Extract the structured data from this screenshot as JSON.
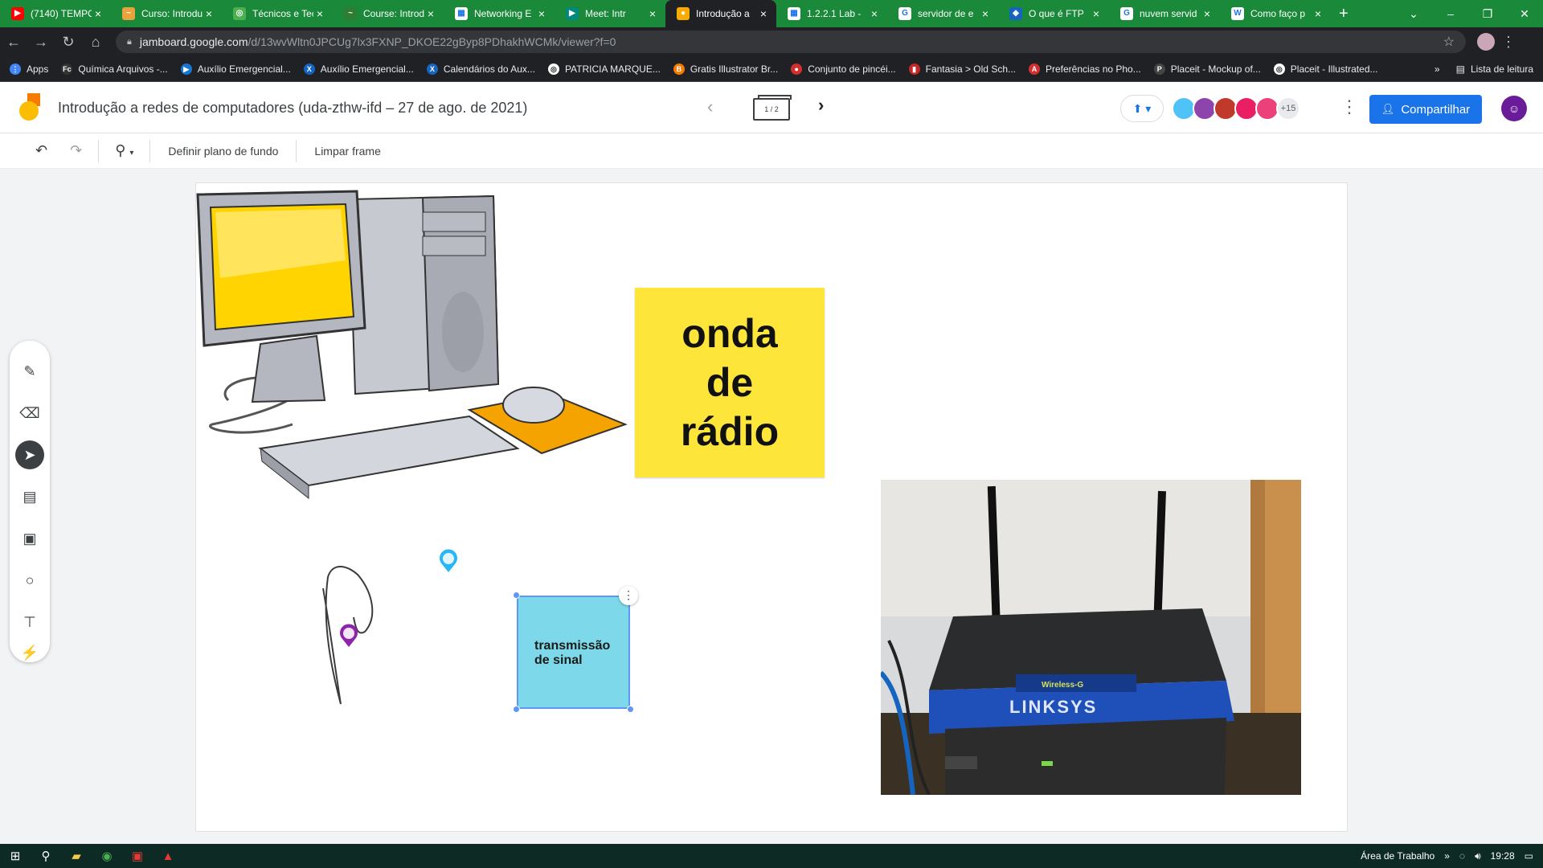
{
  "browser": {
    "tabs": [
      {
        "title": "(7140) TEMPO",
        "favicon_color": "#ff0000",
        "favicon": "▶"
      },
      {
        "title": "Curso: Introdu",
        "favicon_color": "#e8a33d",
        "favicon": "~"
      },
      {
        "title": "Técnicos e Tec",
        "favicon_color": "#4caf50",
        "favicon": "◎"
      },
      {
        "title": "Course: Introd",
        "favicon_color": "#2e7d32",
        "favicon": "~"
      },
      {
        "title": "Networking E",
        "favicon_color": "#ffffff",
        "favicon": "▦"
      },
      {
        "title": "Meet: Intr",
        "favicon_color": "#00897b",
        "favicon": "▶"
      },
      {
        "title": "Introdução a",
        "favicon_color": "#f9ab00",
        "favicon": "●",
        "active": true
      },
      {
        "title": "1.2.2.1 Lab -",
        "favicon_color": "#ffffff",
        "favicon": "▦"
      },
      {
        "title": "servidor de e",
        "favicon_color": "#ffffff",
        "favicon": "G"
      },
      {
        "title": "O que é FTP",
        "favicon_color": "#1565c0",
        "favicon": "◆"
      },
      {
        "title": "nuvem servid",
        "favicon_color": "#ffffff",
        "favicon": "G"
      },
      {
        "title": "Como faço p",
        "favicon_color": "#ffffff",
        "favicon": "W"
      }
    ],
    "address": {
      "host": "jamboard.google.com",
      "path": "/d/13wvWltn0JPCUg7lx3FXNP_DKOE22gByp8PDhakhWCMk/viewer?f=0"
    },
    "bookmarks": [
      {
        "label": "Apps",
        "color": "#4285f4",
        "glyph": "⋮"
      },
      {
        "label": "Química Arquivos -...",
        "color": "#333333",
        "glyph": "Fc"
      },
      {
        "label": "Auxílio Emergencial...",
        "color": "#1976d2",
        "glyph": "▶"
      },
      {
        "label": "Auxílio Emergencial...",
        "color": "#1565c0",
        "glyph": "X"
      },
      {
        "label": "Calendários do Aux...",
        "color": "#1565c0",
        "glyph": "X"
      },
      {
        "label": "PATRICIA MARQUE...",
        "color": "#ffffff",
        "glyph": "◎"
      },
      {
        "label": "Gratis Illustrator Br...",
        "color": "#f57c00",
        "glyph": "B"
      },
      {
        "label": "Conjunto de pincéi...",
        "color": "#d32f2f",
        "glyph": "●"
      },
      {
        "label": "Fantasia > Old Sch...",
        "color": "#c62828",
        "glyph": "▮"
      },
      {
        "label": "Preferências no Pho...",
        "color": "#d32f2f",
        "glyph": "A"
      },
      {
        "label": "Placeit - Mockup of...",
        "color": "#444444",
        "glyph": "P"
      },
      {
        "label": "Placeit - Illustrated...",
        "color": "#ffffff",
        "glyph": "◎"
      }
    ],
    "bookmarks_more": "»",
    "reading_list": "Lista de leitura"
  },
  "jamboard": {
    "title": "Introdução a redes de computadores (uda-zthw-ifd – 27 de ago. de 2021)",
    "frame_indicator": "1 / 2",
    "collaborators_more": "+15",
    "share_label": "Compartilhar",
    "toolbar": {
      "set_background": "Definir plano de fundo",
      "clear_frame": "Limpar frame"
    },
    "sticky_yellow": {
      "text": "onda\nde\nrádio",
      "color": "#fde53a"
    },
    "sticky_blue": {
      "text": "transmissão\nde sinal",
      "color": "#7dd9e9"
    },
    "router_brand": "LINKSYS",
    "router_label": "Wireless-G"
  },
  "taskbar": {
    "desktop_label": "Área de Trabalho",
    "time": "19:28"
  }
}
